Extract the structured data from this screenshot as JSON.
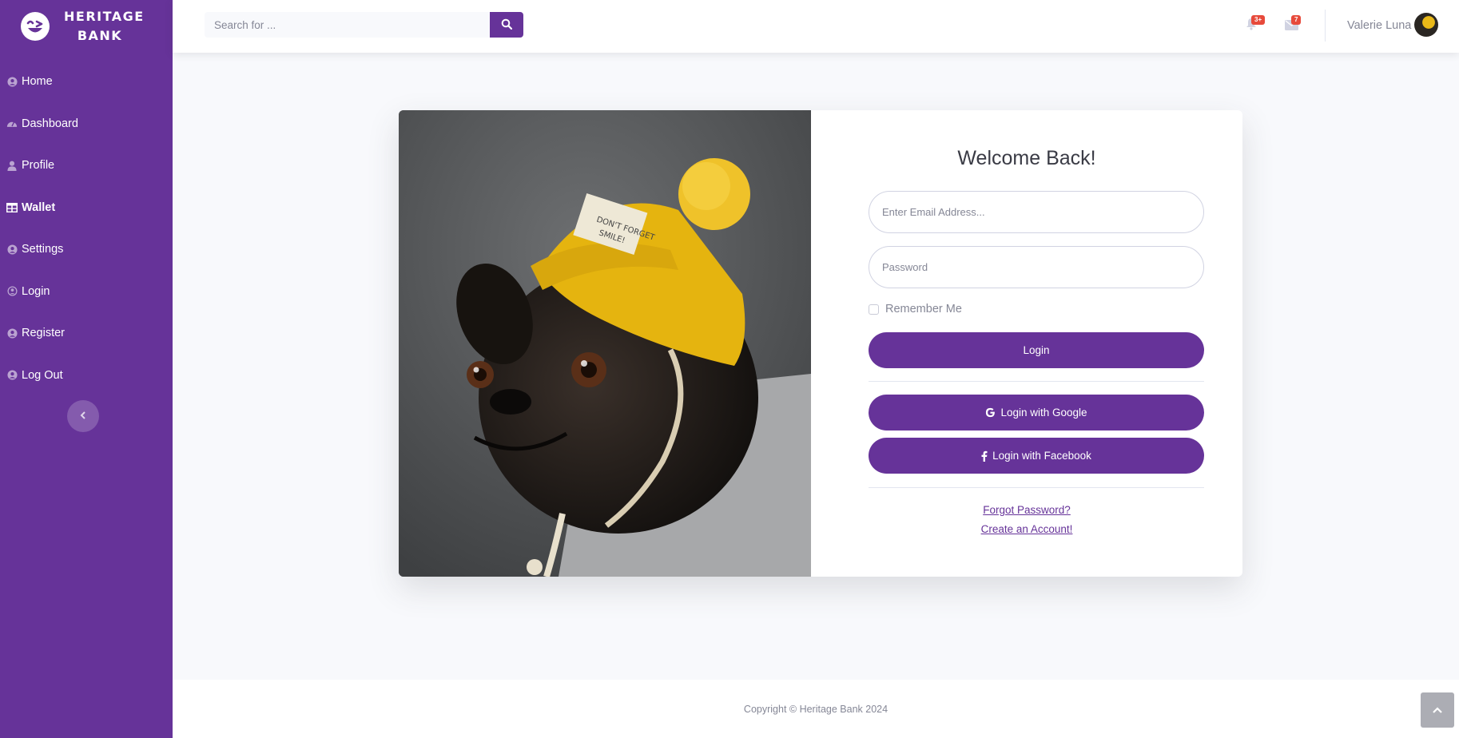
{
  "brand": {
    "line1": "HERITAGE",
    "line2": "BANK",
    "logo_icon": "laughing-face-icon"
  },
  "sidebar": {
    "bg_color": "#663399",
    "items": [
      {
        "label": "Home",
        "icon": "user-circle-icon"
      },
      {
        "label": "Dashboard",
        "icon": "tachometer-icon"
      },
      {
        "label": "Profile",
        "icon": "user-icon"
      },
      {
        "label": "Wallet",
        "icon": "table-icon",
        "active": true
      },
      {
        "label": "Settings",
        "icon": "user-circle-icon"
      },
      {
        "label": "Login",
        "icon": "user-circle-outline-icon"
      },
      {
        "label": "Register",
        "icon": "user-circle-icon"
      },
      {
        "label": "Log Out",
        "icon": "user-circle-icon"
      }
    ],
    "toggle_icon": "chevron-left-icon"
  },
  "topbar": {
    "search_placeholder": "Search for ...",
    "alerts_badge": "3+",
    "messages_badge": "7",
    "user_name": "Valerie Luna"
  },
  "login": {
    "title": "Welcome Back!",
    "email_placeholder": "Enter Email Address...",
    "password_placeholder": "Password",
    "remember_label": "Remember Me",
    "login_button": "Login",
    "google_button": "Login with Google",
    "facebook_button": "Login with Facebook",
    "forgot_link": "Forgot Password?",
    "create_link": "Create an Account!"
  },
  "footer": {
    "copyright": "Copyright © Heritage Bank 2024"
  },
  "colors": {
    "primary": "#663399",
    "badge": "#e74a3b",
    "background": "#f8f9fc"
  }
}
